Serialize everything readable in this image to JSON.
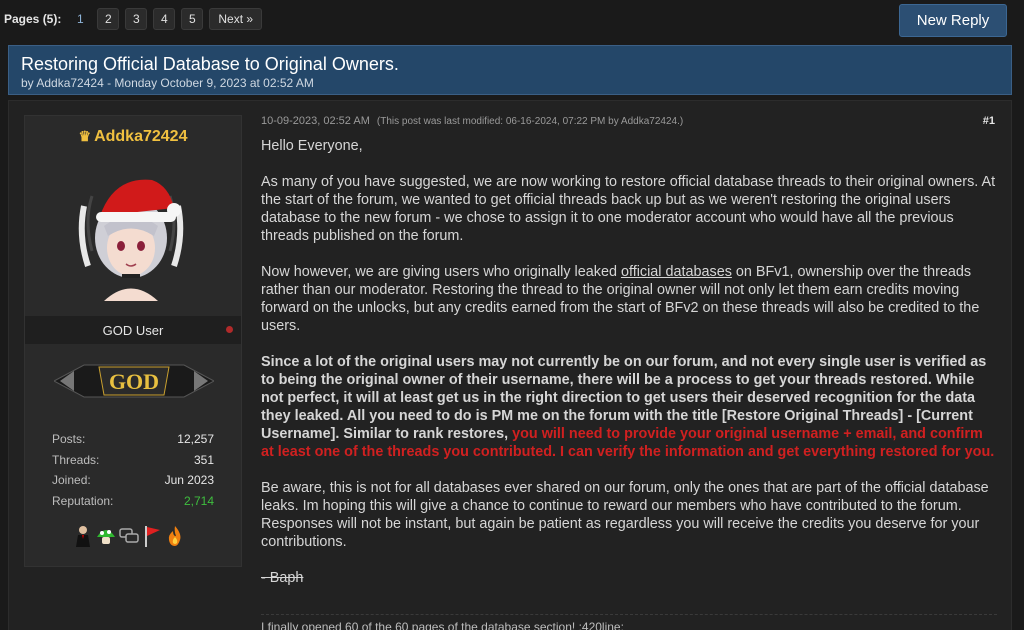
{
  "pagination": {
    "label": "Pages (5):",
    "pages": [
      "1",
      "2",
      "3",
      "4",
      "5"
    ],
    "current": "1",
    "next": "Next »"
  },
  "new_reply_label": "New Reply",
  "thread": {
    "title": "Restoring Official Database to Original Owners.",
    "subtitle": "by Addka72424 - Monday October 9, 2023 at 02:52 AM"
  },
  "user": {
    "name": "Addka72424",
    "role": "GOD User",
    "rank_badge_text": "GOD",
    "stats": [
      {
        "label": "Posts:",
        "value": "12,257"
      },
      {
        "label": "Threads:",
        "value": "351"
      },
      {
        "label": "Joined:",
        "value": "Jun 2023"
      },
      {
        "label": "Reputation:",
        "value": "2,714"
      }
    ],
    "awards": [
      "tuxedo-award-icon",
      "mushroom-award-icon",
      "chat-award-icon",
      "flag-award-icon",
      "fire-award-icon"
    ]
  },
  "post": {
    "date": "10-09-2023, 02:52 AM",
    "modified": "(This post was last modified: 06-16-2024, 07:22 PM by Addka72424.)",
    "number": "#1",
    "greeting": "Hello Everyone,",
    "p1": "As many of you have suggested, we are now working to restore official database threads to their original owners. At the start of the forum, we wanted to get official threads back up but as we weren't restoring the original users database to the new forum - we chose to assign it to one moderator account who would have all the previous threads published on the forum.",
    "p2_a": "Now however, we are giving users who originally leaked ",
    "p2_link": "official databases",
    "p2_b": " on BFv1, ownership over the threads rather than our moderator. Restoring the thread to the original owner will not only let them earn credits moving forward on the unlocks, but any credits earned from the start of BFv2 on these threads will also be credited to the users.",
    "p3_bold": "Since a lot of the original users may not currently be on our forum, and not every single user is verified as to being the original owner of their username, there will be a process to get your threads restored. While not perfect, it will at least get us in the right direction to get users their deserved recognition for the data they leaked. All you need to do is PM me on the forum with the title [Restore Original Threads] - [Current Username]. Similar to rank restores, ",
    "p3_red": "you will need to provide your original username + email, and confirm at least one of the threads you contributed. I can verify the information and get everything restored for you.",
    "p4": "Be aware, this is not for all databases ever shared on our forum, only the ones that are part of the official database leaks. Im hoping this will give a chance to continue to reward our members who have contributed to the forum. Responses will not be instant, but again be patient as regardless you will receive the credits you deserve for your contributions.",
    "signoff": "- Baph",
    "signature": "I finally opened 60 of the 60 pages of the database section! :420line:"
  },
  "colors": {
    "header_bg": "#244769",
    "button_bg": "#2c4f73",
    "username": "#f0c040",
    "red_text": "#d02020",
    "reputation": "#3fbf3f"
  }
}
